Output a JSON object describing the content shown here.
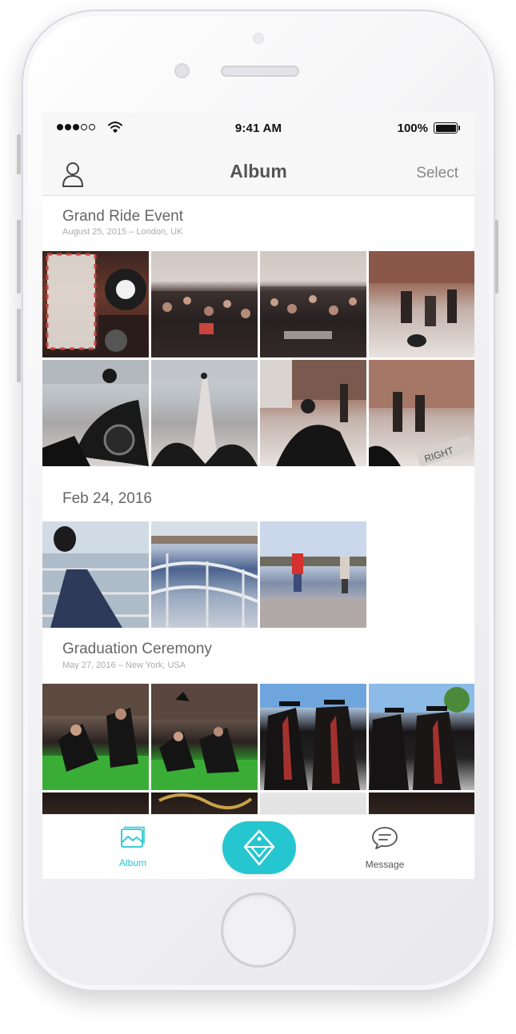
{
  "status_bar": {
    "time": "9:41 AM",
    "battery": "100%",
    "signal_icon": "signal-dots-icon",
    "wifi_icon": "wifi-icon",
    "battery_icon": "battery-icon"
  },
  "nav": {
    "title": "Album",
    "select_label": "Select",
    "user_icon": "user-icon"
  },
  "albums": [
    {
      "title": "Grand Ride Event",
      "subtitle": "August 25, 2015 – London, UK",
      "photo_count": 8
    },
    {
      "title": "Feb 24, 2016",
      "subtitle": "",
      "photo_count": 3
    },
    {
      "title": "Graduation Ceremony",
      "subtitle": "May 27, 2016 – New York, USA",
      "photo_count": 8
    }
  ],
  "tab_bar": {
    "album_label": "Album",
    "message_label": "Message",
    "active_tab": "Album",
    "accent_color": "#26c6d0",
    "album_icon": "photo-icon",
    "message_icon": "chat-bubble-icon",
    "center_icon": "diamond-logo-icon"
  }
}
